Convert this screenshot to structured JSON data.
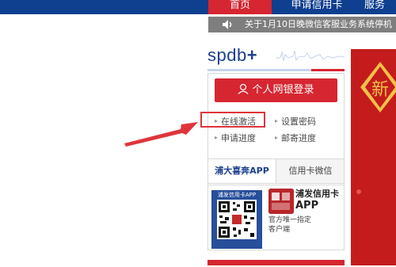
{
  "nav": {
    "home": "首页",
    "apply": "申请信用卡",
    "service": "服务"
  },
  "notice": {
    "text": "关于1月10日晚微信客服业务系统停机"
  },
  "logo": {
    "text": "spdb",
    "plus": "+"
  },
  "login": {
    "button_label": "个人网银登录",
    "links": [
      "在线激活",
      "设置密码",
      "申请进度",
      "邮寄进度"
    ]
  },
  "tabs": [
    "浦大喜奔APP",
    "信用卡微信"
  ],
  "app": {
    "qr_title": "浦发信用卡APP",
    "name_line1": "浦发信用卡",
    "name_line2": "APP",
    "desc": "官方唯一指定客户端"
  },
  "banner": {
    "char": "新"
  },
  "colors": {
    "nav_blue": "#0f3f8f",
    "brand_red": "#d62631",
    "logo_blue": "#1b3f8c",
    "annotation_red": "#e0343b"
  },
  "icons": [
    "speaker-icon",
    "user-icon",
    "qr-code",
    "red-arrow"
  ]
}
